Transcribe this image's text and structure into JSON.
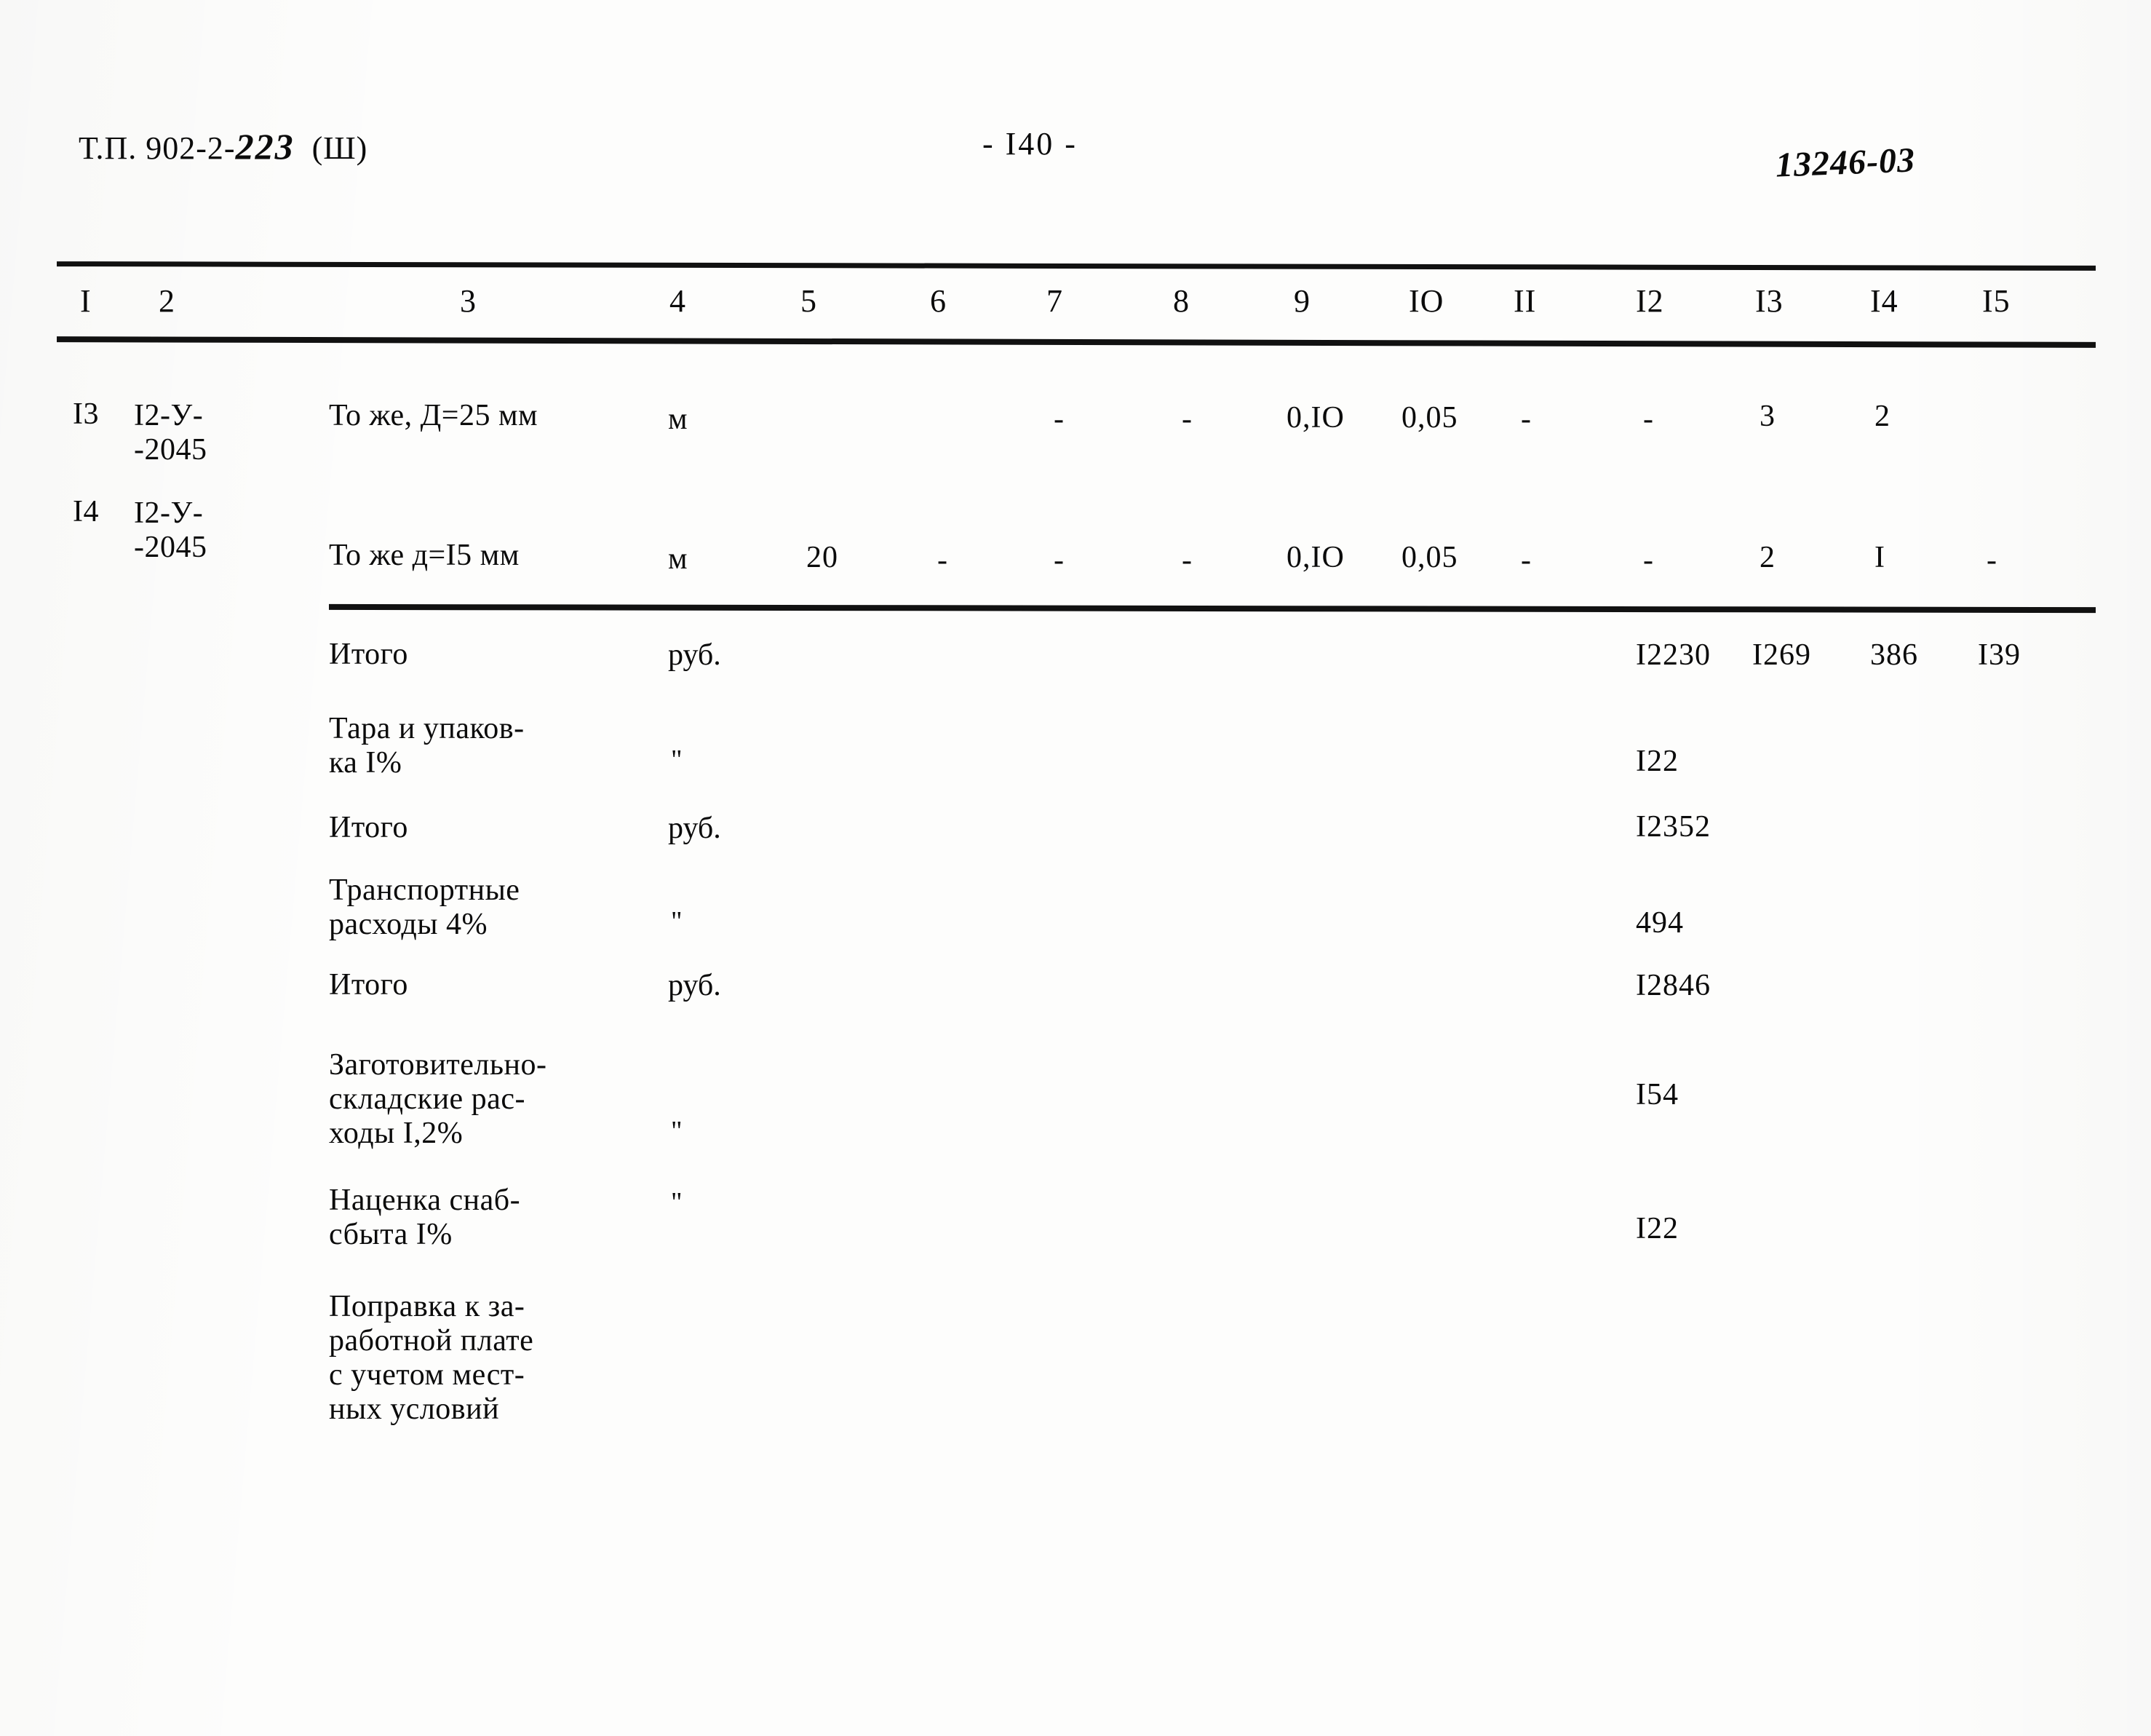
{
  "header": {
    "series_label": "Т.П. 902-2-",
    "series_number": "223",
    "album": "(Ш)",
    "page_number": "- I40 -",
    "handwritten_mark": "13246-03"
  },
  "table": {
    "column_headers": [
      "I",
      "2",
      "3",
      "4",
      "5",
      "6",
      "7",
      "8",
      "9",
      "IO",
      "II",
      "I2",
      "I3",
      "I4",
      "I5"
    ],
    "rows": [
      {
        "no": "I3",
        "code": "I2-У-\n-2045",
        "description": "То же, Д=25 мм",
        "unit": "м",
        "qty": "",
        "c6": "",
        "c7": "-",
        "c8": "-",
        "c9": "0,IO",
        "c10": "0,05",
        "c11": "-",
        "c12": "-",
        "c13": "3",
        "c14": "2",
        "c15": ""
      },
      {
        "no": "I4",
        "code": "I2-У-\n-2045",
        "description": "То же  д=I5 мм",
        "unit": "м",
        "qty": "20",
        "c6": "-",
        "c7": "-",
        "c8": "-",
        "c9": "0,IO",
        "c10": "0,05",
        "c11": "-",
        "c12": "-",
        "c13": "2",
        "c14": "I",
        "c15": "-"
      }
    ],
    "summary": [
      {
        "label": "Итого",
        "unit": "руб.",
        "c12": "I2230",
        "c13": "I269",
        "c14": "386",
        "c15": "I39"
      },
      {
        "label": "Тара и упаков-\nка I%",
        "unit": "\"",
        "c12": "I22",
        "c13": "",
        "c14": "",
        "c15": ""
      },
      {
        "label": "Итого",
        "unit": "руб.",
        "c12": "I2352",
        "c13": "",
        "c14": "",
        "c15": ""
      },
      {
        "label": "Транспортные\nрасходы 4%",
        "unit": "\"",
        "c12": "494",
        "c13": "",
        "c14": "",
        "c15": ""
      },
      {
        "label": "Итого",
        "unit": "руб.",
        "c12": "I2846",
        "c13": "",
        "c14": "",
        "c15": ""
      },
      {
        "label": "Заготовительно-\nскладские рас-\nходы I,2%",
        "unit": "\"",
        "c12": "I54",
        "c13": "",
        "c14": "",
        "c15": ""
      },
      {
        "label": "Наценка снаб-\nсбыта I%",
        "unit": "\"",
        "c12": "I22",
        "c13": "",
        "c14": "",
        "c15": ""
      },
      {
        "label": "Поправка к за-\nработной плате\nс учетом мест-\nных условий",
        "unit": "",
        "c12": "",
        "c13": "",
        "c14": "",
        "c15": ""
      }
    ]
  }
}
